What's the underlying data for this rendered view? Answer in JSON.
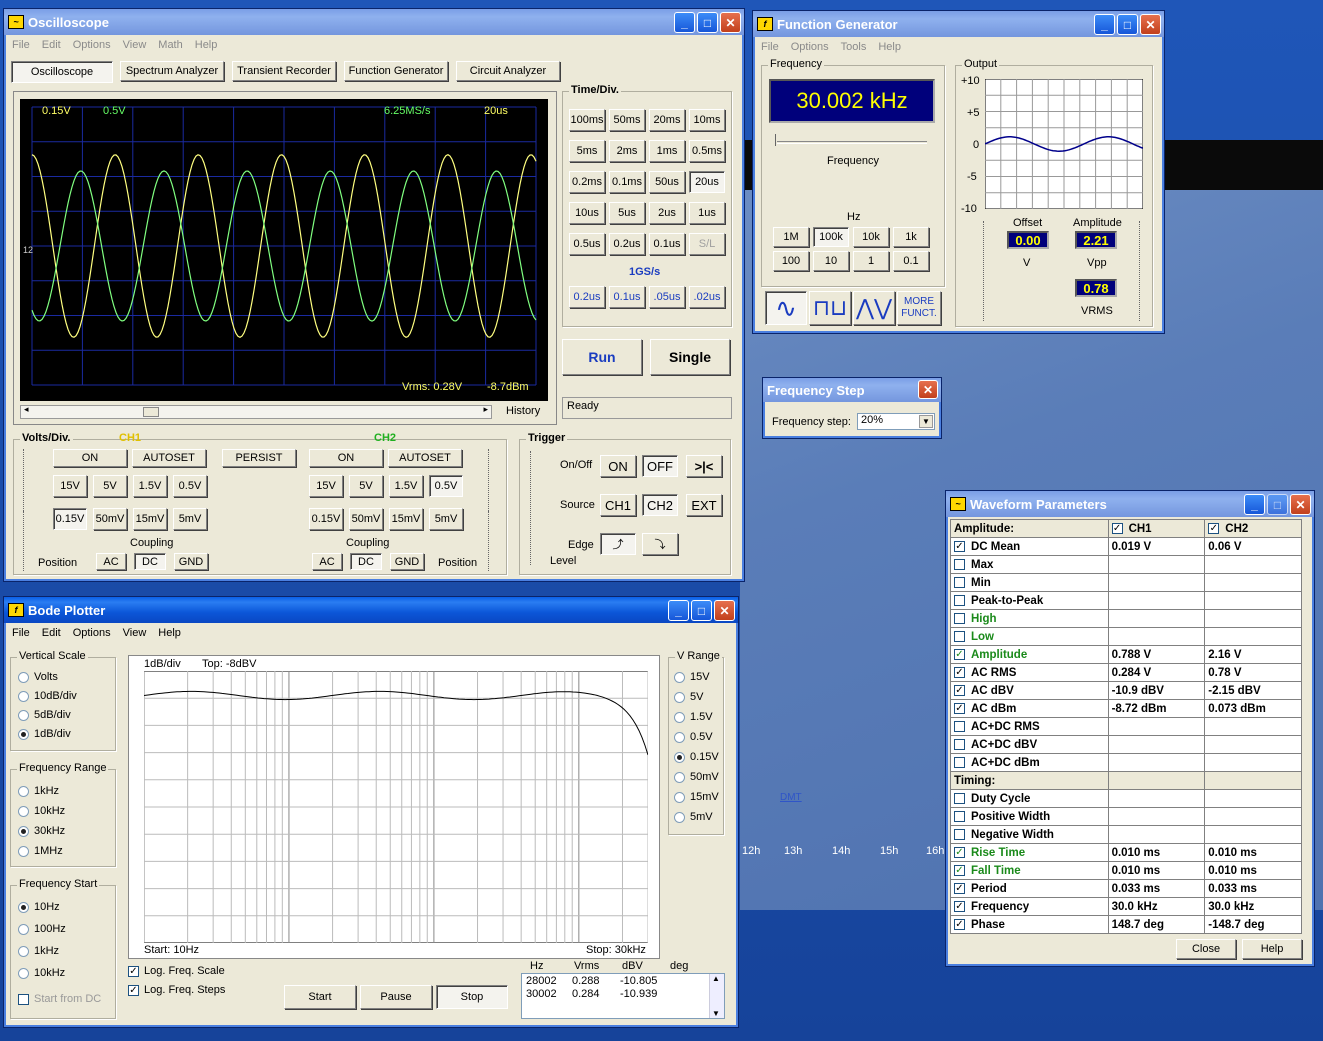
{
  "osc": {
    "title": "Oscilloscope",
    "menu": [
      "File",
      "Edit",
      "Options",
      "View",
      "Math",
      "Help"
    ],
    "tabs": [
      "Oscilloscope",
      "Spectrum Analyzer",
      "Transient Recorder",
      "Function Generator",
      "Circuit Analyzer"
    ],
    "screen": {
      "ch1_scale": "0.15V",
      "ch2_scale": "0.5V",
      "rate": "6.25MS/s",
      "timediv": "20us",
      "vrms": "Vrms: 0.28V",
      "dbm": "-8.7dBm",
      "marker": "12"
    },
    "history": "History",
    "status": "Ready",
    "time_label": "Time/Div.",
    "time_buttons": [
      "100ms",
      "50ms",
      "20ms",
      "10ms",
      "5ms",
      "2ms",
      "1ms",
      "0.5ms",
      "0.2ms",
      "0.1ms",
      "50us",
      "20us",
      "10us",
      "5us",
      "2us",
      "1us",
      "0.5us",
      "0.2us",
      "0.1us",
      "S/L"
    ],
    "gs_label": "1GS/s",
    "gs_buttons": [
      "0.2us",
      "0.1us",
      ".05us",
      ".02us"
    ],
    "run": "Run",
    "single": "Single",
    "volts_label": "Volts/Div.",
    "ch1": "CH1",
    "ch2": "CH2",
    "on": "ON",
    "autoset": "AUTOSET",
    "persist": "PERSIST",
    "vbuttons": [
      "15V",
      "5V",
      "1.5V",
      "0.5V",
      "0.15V",
      "50mV",
      "15mV",
      "5mV"
    ],
    "coupling": "Coupling",
    "ac": "AC",
    "dc": "DC",
    "gnd": "GND",
    "position": "Position",
    "trigger": {
      "label": "Trigger",
      "onoff": "On/Off",
      "on": "ON",
      "off": "OFF",
      "auto": ">|<",
      "source": "Source",
      "ch1": "CH1",
      "ch2": "CH2",
      "ext": "EXT",
      "edge": "Edge",
      "level": "Level"
    }
  },
  "fg": {
    "title": "Function Generator",
    "menu": [
      "File",
      "Options",
      "Tools",
      "Help"
    ],
    "freq_group": "Frequency",
    "freq_value": "30.002 kHz",
    "freq_label": "Frequency",
    "hz": "Hz",
    "range_buttons": [
      "1M",
      "100k",
      "10k",
      "1k",
      "100",
      "10",
      "1",
      "0.1"
    ],
    "more": "MORE",
    "funct": "FUNCT.",
    "output": "Output",
    "yticks": [
      "+10",
      "+5",
      "0",
      "-5",
      "-10"
    ],
    "offset": "Offset",
    "offset_val": "0.00",
    "v": "V",
    "amplitude": "Amplitude",
    "amp_val": "2.21",
    "vpp": "Vpp",
    "vrms_val": "0.78",
    "vrms": "VRMS"
  },
  "fstep": {
    "title": "Frequency Step",
    "label": "Frequency step:",
    "value": "20%"
  },
  "wp": {
    "title": "Waveform Parameters",
    "head": [
      "Amplitude:",
      "CH1",
      "CH2"
    ],
    "rows": [
      [
        "DC  Mean",
        "0.019 V",
        "0.06 V"
      ],
      [
        "Max",
        "",
        ""
      ],
      [
        "Min",
        "",
        ""
      ],
      [
        "Peak-to-Peak",
        "",
        ""
      ],
      [
        "High",
        "",
        ""
      ],
      [
        "Low",
        "",
        ""
      ],
      [
        "Amplitude",
        "0.788 V",
        "2.16 V"
      ],
      [
        "AC RMS",
        "0.284 V",
        "0.78 V"
      ],
      [
        "AC dBV",
        "-10.9 dBV",
        "-2.15 dBV"
      ],
      [
        "AC dBm",
        "-8.72 dBm",
        "0.073 dBm"
      ],
      [
        "AC+DC RMS",
        "",
        ""
      ],
      [
        "AC+DC dBV",
        "",
        ""
      ],
      [
        "AC+DC dBm",
        "",
        ""
      ]
    ],
    "timing": "Timing:",
    "trows": [
      [
        "Duty Cycle",
        "",
        ""
      ],
      [
        "Positive Width",
        "",
        ""
      ],
      [
        "Negative Width",
        "",
        ""
      ],
      [
        "Rise Time",
        "0.010 ms",
        "0.010 ms"
      ],
      [
        "Fall Time",
        "0.010 ms",
        "0.010 ms"
      ],
      [
        "Period",
        "0.033 ms",
        "0.033 ms"
      ],
      [
        "Frequency",
        "30.0 kHz",
        "30.0 kHz"
      ],
      [
        "Phase",
        "148.7 deg",
        "-148.7 deg"
      ]
    ],
    "close": "Close",
    "help": "Help"
  },
  "bode": {
    "title": "Bode Plotter",
    "menu": [
      "File",
      "Edit",
      "Options",
      "View",
      "Help"
    ],
    "vscale": "Vertical Scale",
    "vscale_opts": [
      "Volts",
      "10dB/div",
      "5dB/div",
      "1dB/div"
    ],
    "frange": "Frequency Range",
    "frange_opts": [
      "1kHz",
      "10kHz",
      "30kHz",
      "1MHz"
    ],
    "fstart": "Frequency Start",
    "fstart_opts": [
      "10Hz",
      "100Hz",
      "1kHz",
      "10kHz"
    ],
    "start_dc": "Start from DC",
    "plot_scale": "1dB/div",
    "plot_top": "Top:  -8dBV",
    "start": "Start: 10Hz",
    "stop": "Stop: 30kHz",
    "vrange": "V Range",
    "vrange_opts": [
      "15V",
      "5V",
      "1.5V",
      "0.5V",
      "0.15V",
      "50mV",
      "15mV",
      "5mV"
    ],
    "logscale": "Log. Freq. Scale",
    "logsteps": "Log. Freq. Steps",
    "btn_start": "Start",
    "btn_pause": "Pause",
    "btn_stop": "Stop",
    "tbl_head": [
      "Hz",
      "Vrms",
      "dBV",
      "deg"
    ],
    "tbl_rows": [
      [
        "28002",
        "0.288",
        "-10.805"
      ],
      [
        "30002",
        "0.284",
        "-10.939"
      ]
    ]
  },
  "map": {
    "hours": [
      "12h",
      "13h",
      "14h",
      "15h",
      "16h"
    ],
    "dmt": "DMT"
  }
}
